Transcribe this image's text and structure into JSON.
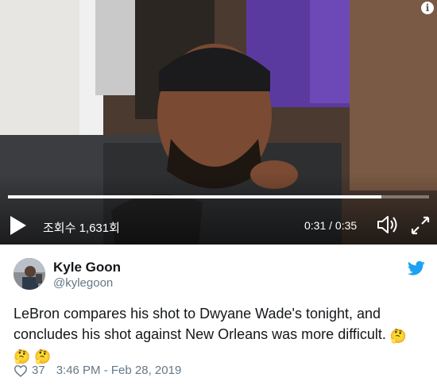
{
  "video": {
    "view_count_label": "조회수 1,631회",
    "time_label": "0:31 / 0:35",
    "progress_fraction": 0.886,
    "info_symbol": "i",
    "icons": {
      "play": "play-icon",
      "volume": "volume-icon",
      "fullscreen": "fullscreen-icon",
      "info": "info-icon"
    }
  },
  "tweet": {
    "display_name": "Kyle Goon",
    "handle": "@kylegoon",
    "text": "LeBron compares his shot to Dwyane Wade's tonight, and concludes his shot against New Orleans was more difficult.",
    "emojis": [
      "🤔",
      "🤔",
      "🤔"
    ],
    "like_count": "37",
    "timestamp": "3:46 PM - Feb 28, 2019",
    "colors": {
      "twitter_blue": "#1da1f2",
      "text": "#14171a",
      "secondary": "#657786"
    }
  }
}
